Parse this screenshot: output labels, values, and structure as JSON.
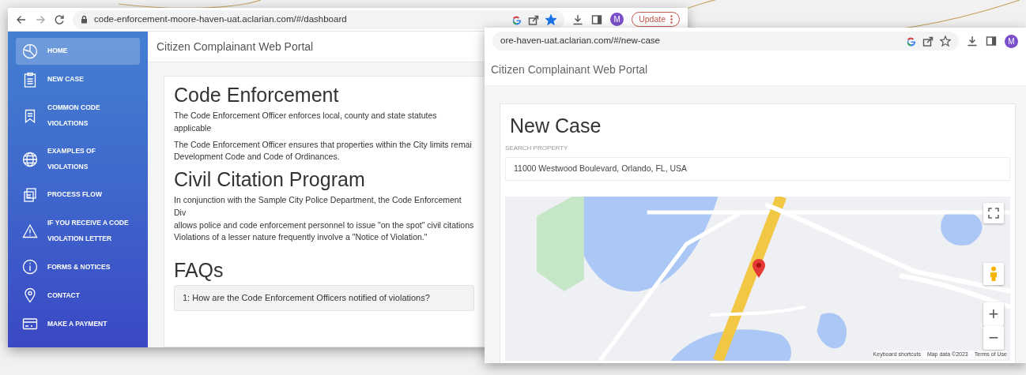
{
  "dashboard_window": {
    "address_bar": {
      "url": "code-enforcement-moore-haven-uat.aclarian.com/#/dashboard",
      "bookmarked": true
    },
    "profile_initial": "M",
    "update_button": "Update",
    "portal_title": "Citizen Complainant Web Portal",
    "sidebar": {
      "items": [
        {
          "label": "HOME",
          "selected": true
        },
        {
          "label": "NEW CASE",
          "selected": false
        },
        {
          "label": "COMMON CODE VIOLATIONS",
          "selected": false
        },
        {
          "label": "EXAMPLES OF VIOLATIONS",
          "selected": false
        },
        {
          "label": "PROCESS FLOW",
          "selected": false
        },
        {
          "label": "IF YOU RECEIVE A CODE VIOLATION LETTER",
          "selected": false
        },
        {
          "label": "FORMS & NOTICES",
          "selected": false
        },
        {
          "label": "CONTACT",
          "selected": false
        },
        {
          "label": "MAKE A PAYMENT",
          "selected": false
        }
      ]
    },
    "sections": [
      {
        "heading": "Code Enforcement",
        "paragraphs": [
          [
            "The Code Enforcement Officer enforces local, county and state statutes applicable"
          ],
          [
            "The Code Enforcement Officer ensures that properties within the City limits remai",
            "Development Code and Code of Ordinances."
          ]
        ]
      },
      {
        "heading": "Civil Citation Program",
        "paragraphs": [
          [
            "In conjunction with the Sample City Police Department, the Code Enforcement Div",
            "allows police and code enforcement personnel to issue \"on the spot\" civil citations",
            "Violations of a lesser nature frequently involve a \"Notice of Violation.\""
          ]
        ]
      },
      {
        "heading": "FAQs",
        "faqs": [
          "1: How are the Code Enforcement Officers notified of violations?"
        ]
      }
    ]
  },
  "new_case_window": {
    "address_bar": {
      "url": "ore-haven-uat.aclarian.com/#/new-case",
      "bookmarked": false
    },
    "profile_initial": "M",
    "portal_title": "Citizen Complainant Web Portal",
    "page_title": "New Case",
    "search_property": {
      "label": "SEARCH PROPERTY",
      "value": "11000 Westwood Boulevard, Orlando, FL, USA"
    },
    "map": {
      "zoom_in": "+",
      "zoom_out": "−",
      "attribution": [
        "Keyboard shortcuts",
        "Map data ©2023",
        "Terms of Use"
      ]
    }
  }
}
